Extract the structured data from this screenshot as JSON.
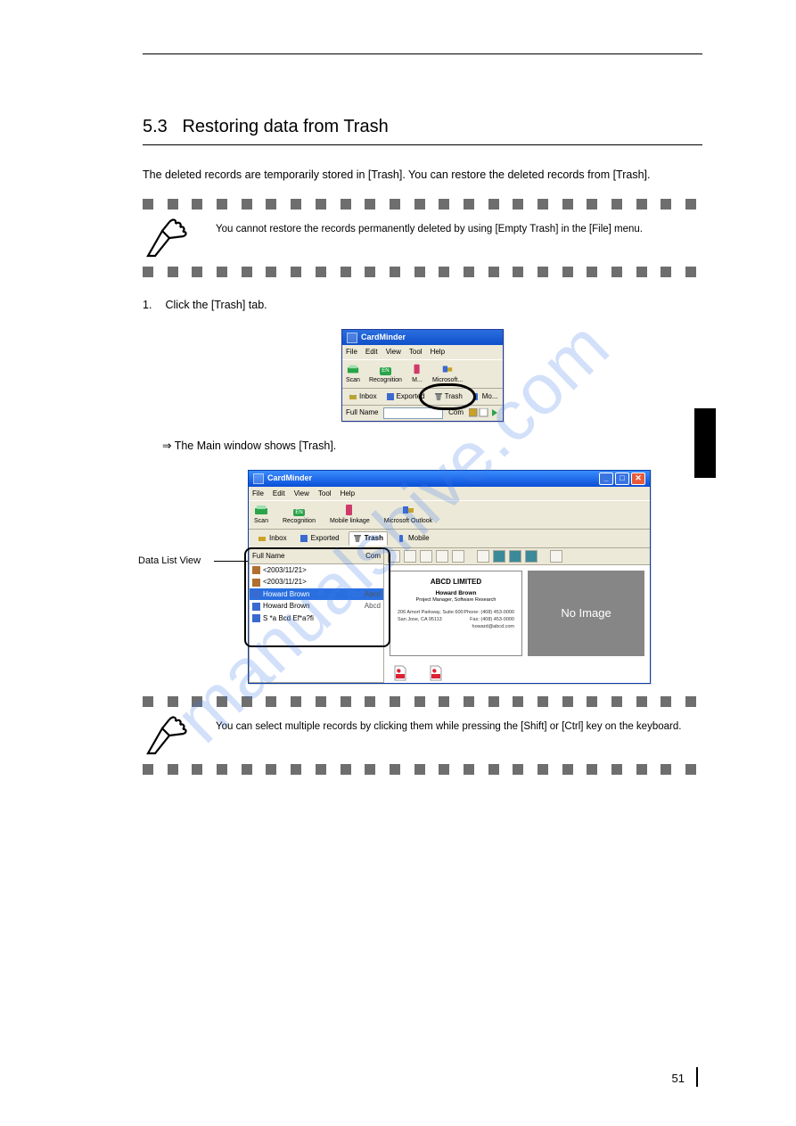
{
  "watermark": "manualshive.com",
  "section": {
    "number": "5.3",
    "title": "Restoring data from Trash"
  },
  "paragraphs": {
    "intro": "The deleted records are temporarily stored in [Trash]. You can restore the deleted records from [Trash].",
    "hint1": "You cannot restore the records permanently deleted by using [Empty Trash] in the [File] menu.",
    "step1_num": "1.",
    "step1_txt": "Click the [Trash] tab.",
    "arrow1": "⇒ The Main window shows [Trash].",
    "hint2": "You can select multiple records by clicking them while pressing the [Shift] or [Ctrl] key on the keyboard.",
    "callout": "Data List View"
  },
  "mock1": {
    "title": "CardMinder",
    "menus": [
      "File",
      "Edit",
      "View",
      "Tool",
      "Help"
    ],
    "toolbar": [
      {
        "label": "Scan",
        "color": "#2aa44a"
      },
      {
        "label": "Recognition",
        "color": "#2aa44a",
        "badge": "EN"
      },
      {
        "label": "M...",
        "color": "#d03a6a"
      },
      {
        "label": "Microsoft...",
        "color": "#3a6ad0"
      }
    ],
    "tabs": [
      {
        "icon": "inbox",
        "label": "Inbox"
      },
      {
        "icon": "export",
        "label": "Exported"
      },
      {
        "icon": "trash",
        "label": "Trash"
      },
      {
        "icon": "mobile",
        "label": "Mo..."
      }
    ],
    "status_label": "Full Name",
    "status_right": "Com"
  },
  "mock2": {
    "title": "CardMinder",
    "menus": [
      "File",
      "Edit",
      "View",
      "Tool",
      "Help"
    ],
    "toolbar": [
      {
        "label": "Scan",
        "color": "#2aa44a"
      },
      {
        "label": "Recognition",
        "color": "#2aa44a",
        "badge": "EN"
      },
      {
        "label": "Mobile linkage",
        "color": "#d03a6a"
      },
      {
        "label": "Microsoft Outlook",
        "color": "#c9a227"
      }
    ],
    "tabs": [
      {
        "icon": "inbox",
        "label": "Inbox"
      },
      {
        "icon": "export",
        "label": "Exported"
      },
      {
        "icon": "trash",
        "label": "Trash",
        "active": true
      },
      {
        "icon": "mobile",
        "label": "Mobile"
      }
    ],
    "list": {
      "header_left": "Full Name",
      "header_right": "Com",
      "rows": [
        {
          "name": "<2003/11/21>",
          "company": ""
        },
        {
          "name": "<2003/11/21>",
          "company": ""
        },
        {
          "name": "Howard Brown",
          "company": "Abcd",
          "selected": true
        },
        {
          "name": "Howard Brown",
          "company": "Abcd"
        },
        {
          "name": "S *a Bcd Ef*a?fi",
          "company": ""
        }
      ]
    },
    "card": {
      "company": "ABCD LIMITED",
      "name": "Howard Brown",
      "title": "Project Manager, Software Research",
      "addr1": "206 Amort Parkway, Suite 600",
      "addr2": "San Jose, CA 95113",
      "phone": "Phone: (408) 453-0000",
      "fax": "Fax: (408) 453-0000",
      "email": "howard@abcd.com"
    },
    "noimage": "No Image"
  },
  "page_number": "51"
}
